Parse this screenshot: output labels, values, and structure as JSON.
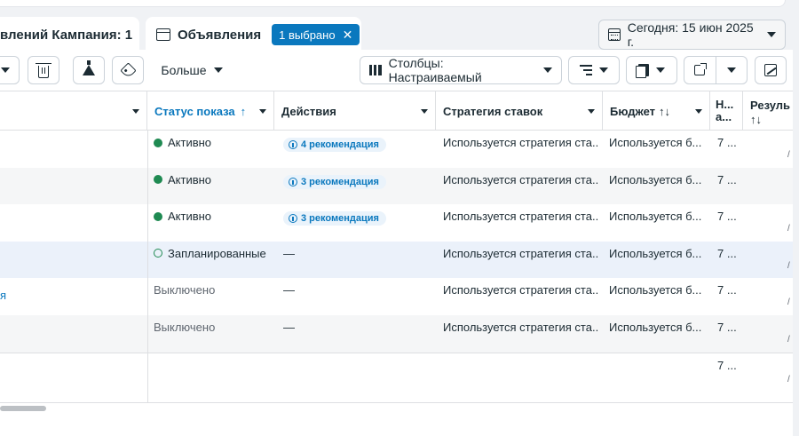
{
  "tabs": {
    "campaign_label": "влений Кампания: 1",
    "ads_label": "Объявления",
    "selected_label": "1 выбрано",
    "close_glyph": "✕"
  },
  "date_range": {
    "label": "Сегодня: 15 июн 2025 г."
  },
  "toolbar": {
    "more_label": "Больше",
    "columns_label": "Столбцы: Настраиваемый"
  },
  "table": {
    "headers": {
      "status": "Статус показа",
      "status_sort": "↑",
      "actions": "Действия",
      "bid": "Стратегия ставок",
      "budget": "Бюджет",
      "budget_sort": "↑↓",
      "na": "Н... а...",
      "results": "Резуль",
      "results_sort": "↑↓"
    },
    "rows": [
      {
        "name": "",
        "status": "Активно",
        "status_type": "active",
        "action": "4 рекомендация",
        "bid": "Используется стратегия ста...",
        "budget": "Используется б...",
        "na": "7 ...",
        "res": "/"
      },
      {
        "name": "",
        "status": "Активно",
        "status_type": "active",
        "action": "3 рекомендация",
        "bid": "Используется стратегия ста...",
        "budget": "Используется б...",
        "na": "7 ...",
        "res": ""
      },
      {
        "name": "",
        "status": "Активно",
        "status_type": "active",
        "action": "3 рекомендация",
        "bid": "Используется стратегия ста...",
        "budget": "Используется б...",
        "na": "7 ...",
        "res": "/"
      },
      {
        "name": "",
        "status": "Запланированные",
        "status_type": "scheduled",
        "action": "—",
        "bid": "Используется стратегия ста...",
        "budget": "Используется б...",
        "na": "7 ...",
        "res": "/"
      },
      {
        "name": "я",
        "status": "Выключено",
        "status_type": "off",
        "action": "—",
        "bid": "Используется стратегия ста...",
        "budget": "Используется б...",
        "na": "7 ...",
        "res": "/"
      },
      {
        "name": "",
        "status": "Выключено",
        "status_type": "off",
        "action": "—",
        "bid": "Используется стратегия ста...",
        "budget": "Используется б...",
        "na": "7 ...",
        "res": "/"
      }
    ],
    "total": {
      "na": "7 ...",
      "res": "/"
    }
  },
  "colors": {
    "accent": "#0a78be",
    "active_dot": "#1f8a52",
    "highlight_row": "#ebf1fa",
    "alt_row": "#f5f6f7"
  }
}
